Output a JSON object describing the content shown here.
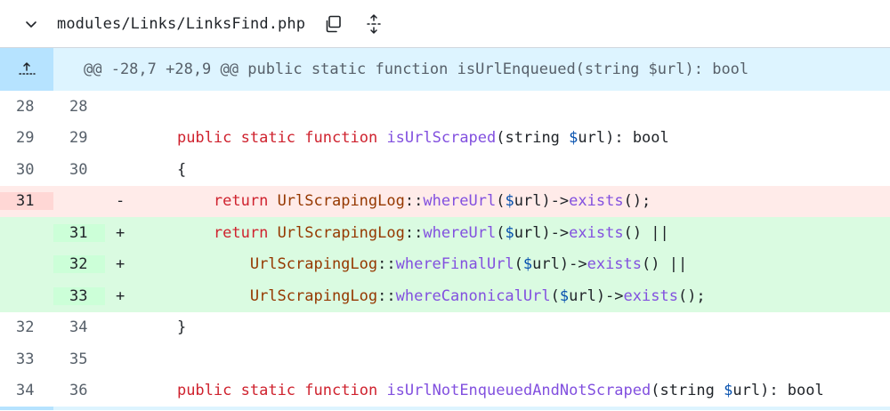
{
  "file": {
    "path": "modules/Links/LinksFind.php",
    "icons": {
      "collapse": "chevron-down-icon",
      "copy": "copy-icon",
      "expand": "unfold-icon"
    }
  },
  "hunk": {
    "header": "@@ -28,7 +28,9 @@ public static function isUrlEnqueued(string $url): bool",
    "icon": "expand-up-icon"
  },
  "lines": [
    {
      "type": "ctx",
      "old": "28",
      "new": "28",
      "marker": "",
      "tokens": []
    },
    {
      "type": "ctx",
      "old": "29",
      "new": "29",
      "marker": "",
      "tokens": [
        {
          "t": "    ",
          "c": "plain"
        },
        {
          "t": "public",
          "c": "kw"
        },
        {
          "t": " ",
          "c": "plain"
        },
        {
          "t": "static",
          "c": "kw"
        },
        {
          "t": " ",
          "c": "plain"
        },
        {
          "t": "function",
          "c": "kw"
        },
        {
          "t": " ",
          "c": "plain"
        },
        {
          "t": "isUrlScraped",
          "c": "fn"
        },
        {
          "t": "(string ",
          "c": "plain"
        },
        {
          "t": "$",
          "c": "var"
        },
        {
          "t": "url): bool",
          "c": "plain"
        }
      ]
    },
    {
      "type": "ctx",
      "old": "30",
      "new": "30",
      "marker": "",
      "tokens": [
        {
          "t": "    {",
          "c": "plain"
        }
      ]
    },
    {
      "type": "del",
      "old": "31",
      "new": "",
      "marker": "-",
      "tokens": [
        {
          "t": "        ",
          "c": "plain"
        },
        {
          "t": "return",
          "c": "kw"
        },
        {
          "t": " ",
          "c": "plain"
        },
        {
          "t": "UrlScrapingLog",
          "c": "cls"
        },
        {
          "t": "::",
          "c": "plain"
        },
        {
          "t": "whereUrl",
          "c": "fn"
        },
        {
          "t": "(",
          "c": "plain"
        },
        {
          "t": "$",
          "c": "var"
        },
        {
          "t": "url)->",
          "c": "plain"
        },
        {
          "t": "exists",
          "c": "fn"
        },
        {
          "t": "();",
          "c": "plain"
        }
      ]
    },
    {
      "type": "add",
      "old": "",
      "new": "31",
      "marker": "+",
      "tokens": [
        {
          "t": "        ",
          "c": "plain"
        },
        {
          "t": "return",
          "c": "kw"
        },
        {
          "t": " ",
          "c": "plain"
        },
        {
          "t": "UrlScrapingLog",
          "c": "cls"
        },
        {
          "t": "::",
          "c": "plain"
        },
        {
          "t": "whereUrl",
          "c": "fn"
        },
        {
          "t": "(",
          "c": "plain"
        },
        {
          "t": "$",
          "c": "var"
        },
        {
          "t": "url)->",
          "c": "plain"
        },
        {
          "t": "exists",
          "c": "fn"
        },
        {
          "t": "() ||",
          "c": "plain"
        }
      ]
    },
    {
      "type": "add",
      "old": "",
      "new": "32",
      "marker": "+",
      "tokens": [
        {
          "t": "            ",
          "c": "plain"
        },
        {
          "t": "UrlScrapingLog",
          "c": "cls"
        },
        {
          "t": "::",
          "c": "plain"
        },
        {
          "t": "whereFinalUrl",
          "c": "fn"
        },
        {
          "t": "(",
          "c": "plain"
        },
        {
          "t": "$",
          "c": "var"
        },
        {
          "t": "url)->",
          "c": "plain"
        },
        {
          "t": "exists",
          "c": "fn"
        },
        {
          "t": "() ||",
          "c": "plain"
        }
      ]
    },
    {
      "type": "add",
      "old": "",
      "new": "33",
      "marker": "+",
      "tokens": [
        {
          "t": "            ",
          "c": "plain"
        },
        {
          "t": "UrlScrapingLog",
          "c": "cls"
        },
        {
          "t": "::",
          "c": "plain"
        },
        {
          "t": "whereCanonicalUrl",
          "c": "fn"
        },
        {
          "t": "(",
          "c": "plain"
        },
        {
          "t": "$",
          "c": "var"
        },
        {
          "t": "url)->",
          "c": "plain"
        },
        {
          "t": "exists",
          "c": "fn"
        },
        {
          "t": "();",
          "c": "plain"
        }
      ]
    },
    {
      "type": "ctx",
      "old": "32",
      "new": "34",
      "marker": "",
      "tokens": [
        {
          "t": "    }",
          "c": "plain"
        }
      ]
    },
    {
      "type": "ctx",
      "old": "33",
      "new": "35",
      "marker": "",
      "tokens": []
    },
    {
      "type": "ctx",
      "old": "34",
      "new": "36",
      "marker": "",
      "tokens": [
        {
          "t": "    ",
          "c": "plain"
        },
        {
          "t": "public",
          "c": "kw"
        },
        {
          "t": " ",
          "c": "plain"
        },
        {
          "t": "static",
          "c": "kw"
        },
        {
          "t": " ",
          "c": "plain"
        },
        {
          "t": "function",
          "c": "kw"
        },
        {
          "t": " ",
          "c": "plain"
        },
        {
          "t": "isUrlNotEnqueuedAndNotScraped",
          "c": "fn"
        },
        {
          "t": "(string ",
          "c": "plain"
        },
        {
          "t": "$",
          "c": "var"
        },
        {
          "t": "url): bool",
          "c": "plain"
        }
      ]
    }
  ],
  "colors": {
    "deletion_bg": "#ffebe9",
    "addition_bg": "#dafbe1",
    "hunk_bg": "#ddf4ff",
    "keyword": "#cf222e",
    "function": "#8250df",
    "class": "#953800"
  }
}
